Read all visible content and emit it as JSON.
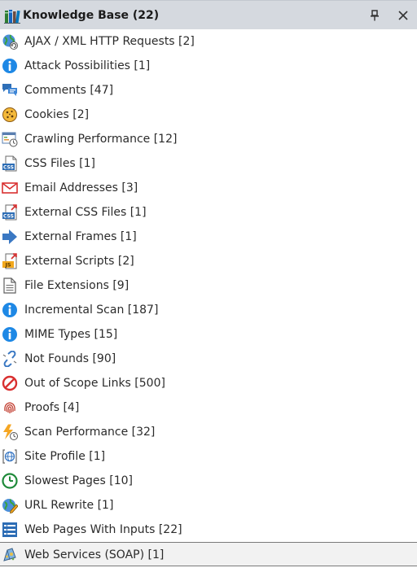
{
  "panel": {
    "title": "Knowledge Base (22)",
    "title_icon": "books-icon",
    "pin_icon": "pin-icon",
    "close_icon": "close-icon"
  },
  "items": [
    {
      "label": "AJAX / XML HTTP Requests [2]",
      "icon": "globe-refresh-icon"
    },
    {
      "label": "Attack Possibilities [1]",
      "icon": "info-icon"
    },
    {
      "label": "Comments [47]",
      "icon": "comments-icon"
    },
    {
      "label": "Cookies [2]",
      "icon": "cookie-icon"
    },
    {
      "label": "Crawling Performance [12]",
      "icon": "crawl-performance-icon"
    },
    {
      "label": "CSS Files [1]",
      "icon": "css-file-icon"
    },
    {
      "label": "Email Addresses [3]",
      "icon": "envelope-icon"
    },
    {
      "label": "External CSS Files [1]",
      "icon": "external-css-icon"
    },
    {
      "label": "External Frames [1]",
      "icon": "arrow-right-icon"
    },
    {
      "label": "External Scripts [2]",
      "icon": "external-js-icon"
    },
    {
      "label": "File Extensions [9]",
      "icon": "document-icon"
    },
    {
      "label": "Incremental Scan [187]",
      "icon": "info-icon"
    },
    {
      "label": "MIME Types [15]",
      "icon": "info-icon"
    },
    {
      "label": "Not Founds [90]",
      "icon": "broken-link-icon"
    },
    {
      "label": "Out of Scope Links [500]",
      "icon": "no-entry-icon"
    },
    {
      "label": "Proofs [4]",
      "icon": "fingerprint-icon"
    },
    {
      "label": "Scan Performance [32]",
      "icon": "lightning-clock-icon"
    },
    {
      "label": "Site Profile [1]",
      "icon": "site-profile-icon"
    },
    {
      "label": "Slowest Pages [10]",
      "icon": "clock-icon"
    },
    {
      "label": "URL Rewrite [1]",
      "icon": "globe-pencil-icon"
    },
    {
      "label": "Web Pages With Inputs [22]",
      "icon": "form-list-icon"
    },
    {
      "label": "Web Services (SOAP) [1]",
      "icon": "soap-icon",
      "selected": true
    }
  ],
  "colors": {
    "header_bg": "#d5d9df",
    "info_blue": "#1e88e5",
    "selection_border": "#7a7a7a"
  }
}
